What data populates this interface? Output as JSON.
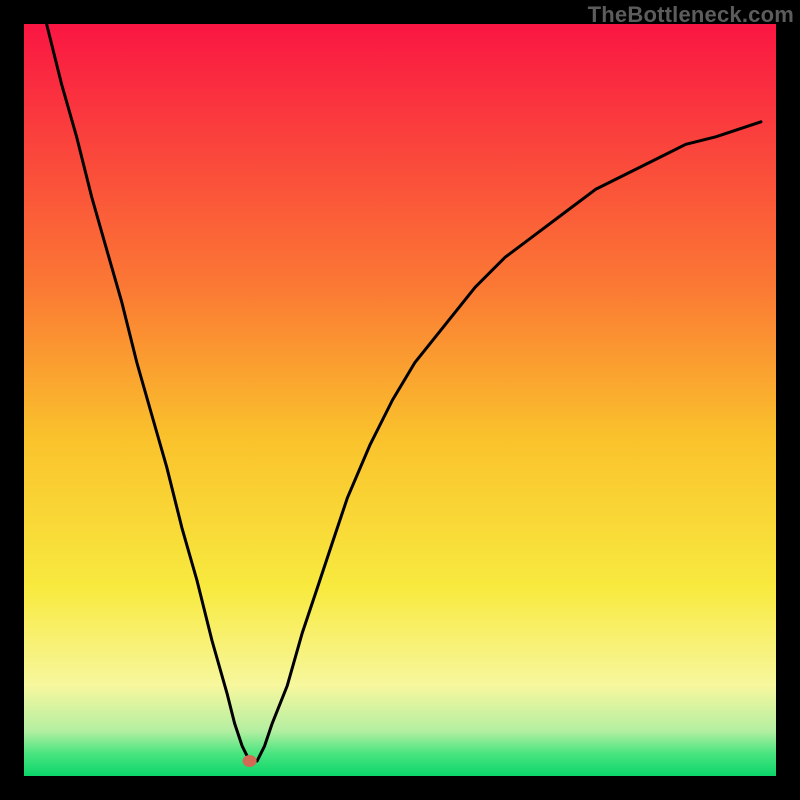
{
  "watermark": "TheBottleneck.com",
  "chart_data": {
    "type": "line",
    "title": "",
    "xlabel": "",
    "ylabel": "",
    "xlim": [
      0,
      100
    ],
    "ylim": [
      0,
      100
    ],
    "grid": false,
    "legend": false,
    "axes_visible": false,
    "annotations": [
      {
        "type": "dot",
        "x": 30,
        "y": 2,
        "color": "#d26a55"
      }
    ],
    "x": [
      3,
      5,
      7,
      9,
      11,
      13,
      15,
      17,
      19,
      21,
      23,
      25,
      27,
      28,
      29,
      30,
      31,
      32,
      33,
      35,
      37,
      39,
      41,
      43,
      46,
      49,
      52,
      56,
      60,
      64,
      68,
      72,
      76,
      80,
      84,
      88,
      92,
      95,
      98
    ],
    "values": [
      100,
      92,
      85,
      77,
      70,
      63,
      55,
      48,
      41,
      33,
      26,
      18,
      11,
      7,
      4,
      2,
      2,
      4,
      7,
      12,
      19,
      25,
      31,
      37,
      44,
      50,
      55,
      60,
      65,
      69,
      72,
      75,
      78,
      80,
      82,
      84,
      85,
      86,
      87
    ],
    "background_gradient": {
      "stops": [
        {
          "pos": 0.0,
          "color": "#fa1643"
        },
        {
          "pos": 0.35,
          "color": "#fb7934"
        },
        {
          "pos": 0.55,
          "color": "#fac22c"
        },
        {
          "pos": 0.75,
          "color": "#f8ea3f"
        },
        {
          "pos": 0.88,
          "color": "#f7f79e"
        },
        {
          "pos": 0.94,
          "color": "#b4efa1"
        },
        {
          "pos": 0.97,
          "color": "#4ae580"
        },
        {
          "pos": 1.0,
          "color": "#0bd56a"
        }
      ]
    },
    "border_px": 24,
    "border_color": "#000000"
  }
}
